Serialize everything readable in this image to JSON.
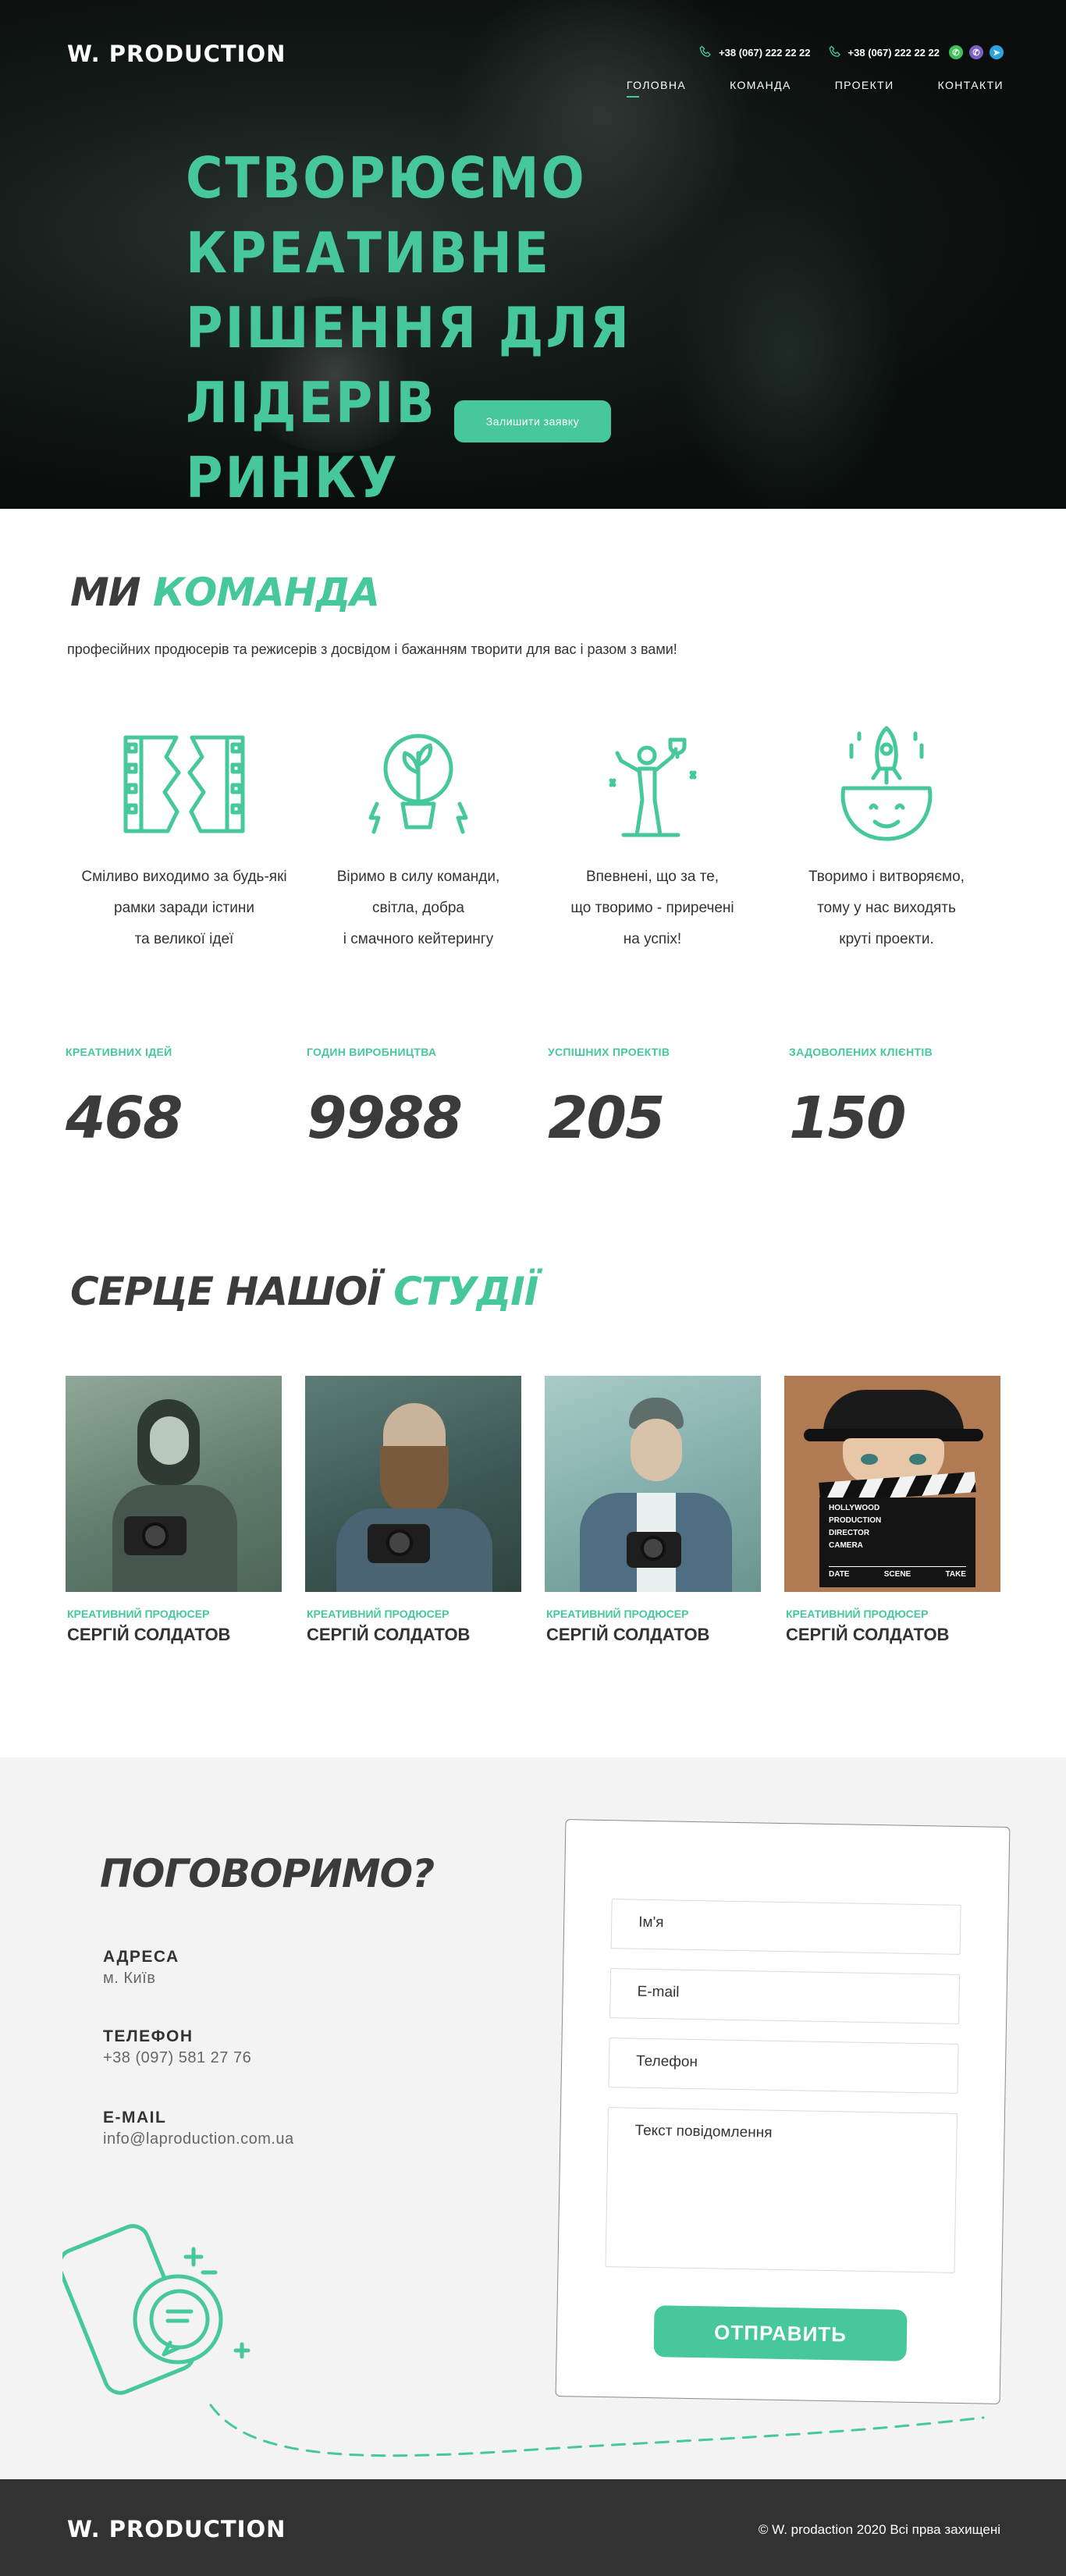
{
  "header": {
    "logo": "W. PRODUCTION",
    "phones": [
      "+38 (067) 222 22 22",
      "+38 (067) 222 22 22"
    ],
    "nav": [
      "ГОЛОВНА",
      "КОМАНДА",
      "ПРОЕКТИ",
      "КОНТАКТИ"
    ]
  },
  "hero": {
    "title_lines": [
      "СТВОРЮЄМО КРЕАТИВНЕ",
      "РІШЕННЯ ДЛЯ ЛІДЕРІВ",
      "РИНКУ"
    ],
    "cta": "Залишити заявку"
  },
  "team": {
    "title_main": "МИ",
    "title_accent": "КОМАНДА",
    "subtitle": "професійних продюсерів та режисерів з досвідом і бажанням творити для вас і разом з вами!",
    "features": [
      {
        "icon": "film-strip-icon",
        "lines": [
          "Сміливо виходимо за будь-які",
          "рамки заради істини",
          "та великої ідеї"
        ]
      },
      {
        "icon": "lightbulb-plant-icon",
        "lines": [
          "Віримо в силу команди,",
          "світла, добра",
          "і смачного кейтерингу"
        ]
      },
      {
        "icon": "trophy-winner-icon",
        "lines": [
          "Впевнені, що за те,",
          "що творимо - приречені",
          "на успіх!"
        ]
      },
      {
        "icon": "rocket-head-icon",
        "lines": [
          "Творимо і витворяємо,",
          "тому у нас виходять",
          "круті проекти."
        ]
      }
    ]
  },
  "stats": [
    {
      "label": "КРЕАТИВНИХ  ІДЕЙ",
      "value": "468"
    },
    {
      "label": "ГОДИН ВИРОБНИЦТВА",
      "value": "9988"
    },
    {
      "label": "УСПІШНИХ ПРОЕКТІВ",
      "value": "205"
    },
    {
      "label": "ЗАДОВОЛЕНИХ КЛІЄНТІВ",
      "value": "150"
    }
  ],
  "studio": {
    "title_main": "СЕРЦЕ НАШОЇ",
    "title_accent": "СТУДІЇ",
    "members": [
      {
        "role": "КРЕАТИВНИЙ ПРОДЮСЕР",
        "name": "СЕРГІЙ СОЛДАТОВ"
      },
      {
        "role": "КРЕАТИВНИЙ ПРОДЮСЕР",
        "name": "СЕРГІЙ СОЛДАТОВ"
      },
      {
        "role": "КРЕАТИВНИЙ ПРОДЮСЕР",
        "name": "СЕРГІЙ СОЛДАТОВ"
      },
      {
        "role": "КРЕАТИВНИЙ ПРОДЮСЕР",
        "name": "СЕРГІЙ СОЛДАТОВ"
      }
    ],
    "clapboard_lines": [
      "HOLLYWOOD",
      "PRODUCTION",
      "DIRECTOR",
      "CAMERA",
      "DATE",
      "SCENE",
      "TAKE"
    ]
  },
  "contact": {
    "title": "ПОГОВОРИМО?",
    "address_label": "АДРЕСА",
    "address": "м. Київ",
    "phone_label": "ТЕЛЕФОН",
    "phone": "+38 (097) 581 27 76",
    "email_label": "E-MAIL",
    "email": "info@laproduction.com.ua",
    "form": {
      "name_placeholder": "Ім'я",
      "email_placeholder": "E-mail",
      "phone_placeholder": "Телефон",
      "message_placeholder": "Текст повідомлення",
      "submit": "ОТПРАВИТЬ"
    }
  },
  "footer": {
    "logo": "W. PRODUCTION",
    "copyright": "© W. prodaction  2020 Всі прва захищені"
  },
  "colors": {
    "accent": "#46c79c",
    "dark": "#3b3b3b",
    "footer": "#323232",
    "contact_bg": "#f3f3f3"
  }
}
